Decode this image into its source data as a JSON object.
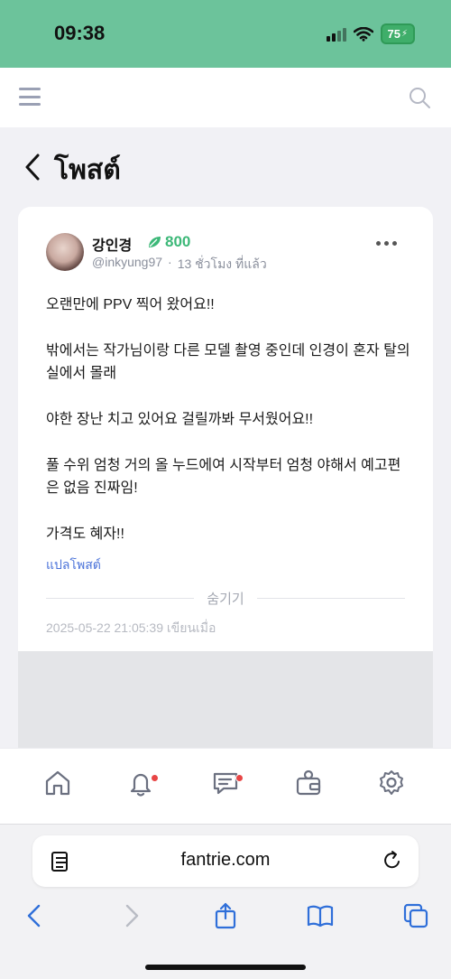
{
  "status_bar": {
    "time": "09:38",
    "battery": "75"
  },
  "page": {
    "title": "โพสต์"
  },
  "post": {
    "author_name": "강인경",
    "points": "800",
    "handle": "@inkyung97",
    "separator": "·",
    "time_ago": "13 ชั่วโมง ที่แล้ว",
    "paragraphs": [
      "오랜만에 PPV 찍어 왔어요!!",
      "밖에서는 작가님이랑 다른 모델 촬영 중인데 인경이 혼자 탈의실에서 몰래",
      "야한 장난 치고 있어요 걸릴까봐 무서웠어요!!",
      "풀 수위 엄청 거의 올 누드에여 시작부터 엄청 야해서 예고편은 없음 진짜임!",
      "가격도 혜자!!"
    ],
    "translate_label": "แปลโพสต์",
    "hide_label": "숨기기",
    "timestamp": "2025-05-22 21:05:39 เขียนเมื่อ"
  },
  "browser": {
    "url": "fantrie.com"
  },
  "colors": {
    "accent_green": "#3cb878",
    "status_bar_bg": "#6cc39b",
    "link_blue": "#4a72d9",
    "notification_red": "#e84545"
  },
  "icons": {
    "bottom_nav": [
      "home-icon",
      "bell-icon",
      "chat-icon",
      "wallet-icon",
      "gear-icon"
    ],
    "browser_toolbar": [
      "back-icon",
      "forward-icon",
      "share-icon",
      "bookmarks-icon",
      "tabs-icon"
    ]
  }
}
